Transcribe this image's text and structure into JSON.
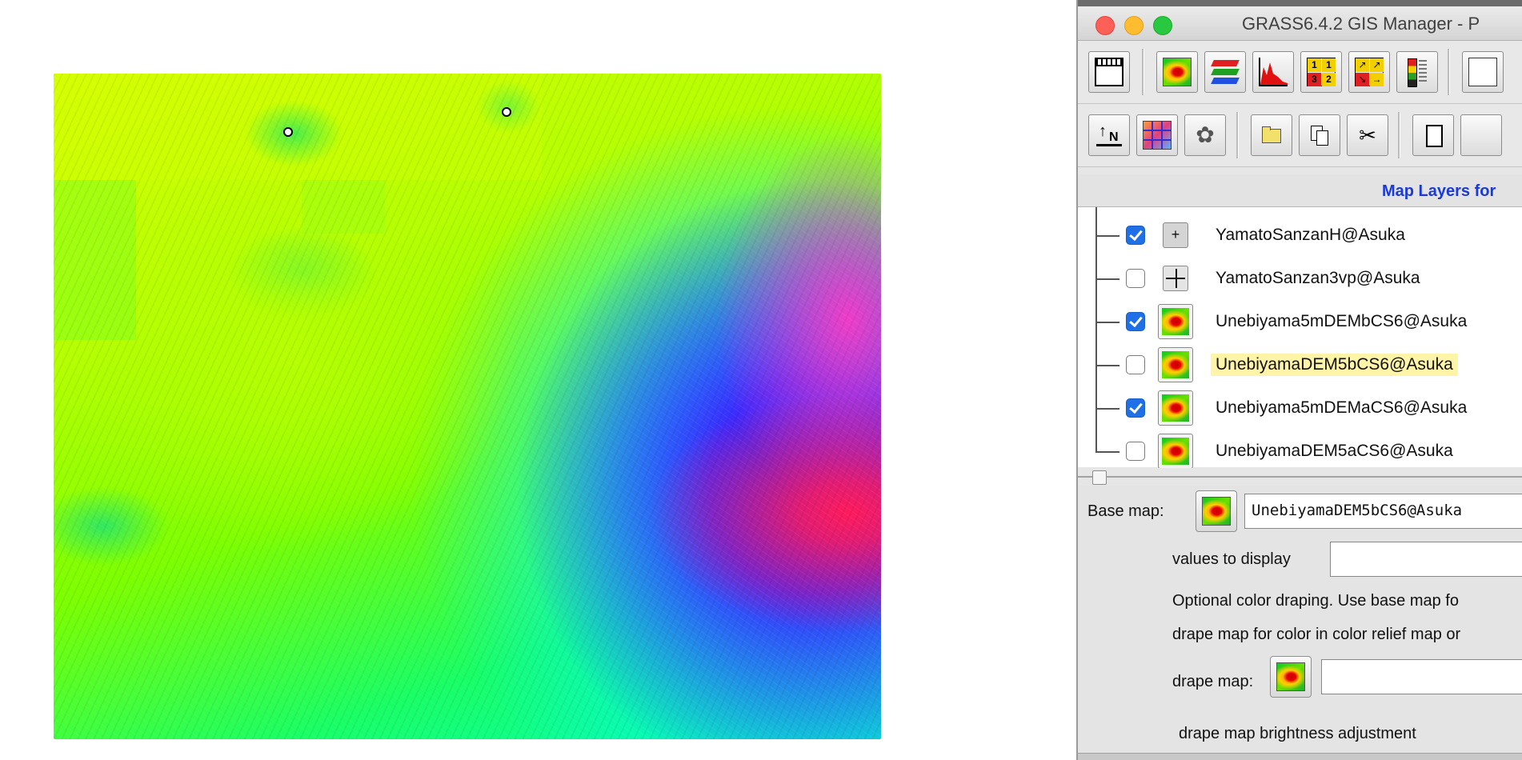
{
  "window": {
    "title": "GRASS6.4.2 GIS Manager - P"
  },
  "colors": {
    "close": "#fe5f57",
    "minimize": "#febc2e",
    "zoom": "#28c840",
    "link_blue": "#1a3ad6",
    "selection": "#fff4a8"
  },
  "toolbar1": {
    "buttons": [
      {
        "icon": "new-display-icon"
      },
      {
        "icon": "raster-map-icon"
      },
      {
        "icon": "vector-layers-icon"
      },
      {
        "icon": "histogram-icon"
      },
      {
        "icon": "raster-labels-icon"
      },
      {
        "icon": "arrows-grid-icon"
      },
      {
        "icon": "legend-icon"
      },
      {
        "icon": "overflow-icon"
      }
    ]
  },
  "toolbar2": {
    "north_label": "N",
    "buttons": [
      {
        "icon": "north-arrow-icon"
      },
      {
        "icon": "grid-icon"
      },
      {
        "icon": "gear-icon"
      },
      {
        "icon": "folder-icon"
      },
      {
        "icon": "copy-icon"
      },
      {
        "icon": "cut-icon"
      },
      {
        "icon": "new-file-icon"
      }
    ]
  },
  "layers": {
    "header": "Map Layers for",
    "items": [
      {
        "name": "YamatoSanzanH@Asuka",
        "checked": true,
        "icon": "point-symbol-icon"
      },
      {
        "name": "YamatoSanzan3vp@Asuka",
        "checked": false,
        "icon": "crosshair-icon"
      },
      {
        "name": "Unebiyama5mDEMbCS6@Asuka",
        "checked": true,
        "icon": "raster-map-icon"
      },
      {
        "name": "UnebiyamaDEM5bCS6@Asuka",
        "checked": false,
        "icon": "raster-map-icon",
        "selected": true
      },
      {
        "name": "Unebiyama5mDEMaCS6@Asuka",
        "checked": true,
        "icon": "raster-map-icon"
      },
      {
        "name": "UnebiyamaDEM5aCS6@Asuka",
        "checked": false,
        "icon": "raster-map-icon"
      }
    ]
  },
  "options": {
    "base_map_label": "Base map:",
    "base_map_value": "UnebiyamaDEM5bCS6@Asuka",
    "values_label": "values to display",
    "values_value": "",
    "drape_note_1": "Optional color draping. Use base map fo",
    "drape_note_2": "drape map for color in color relief map or",
    "drape_map_label": "drape map:",
    "drape_map_value": "",
    "brightness_label": "drape map brightness adjustment"
  }
}
